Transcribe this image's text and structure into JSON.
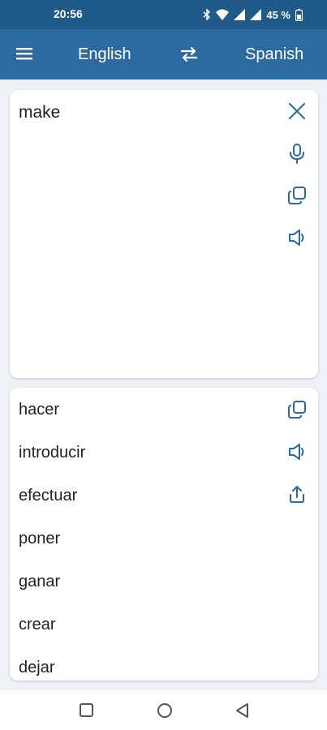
{
  "status_bar": {
    "time": "20:56",
    "battery": "45 %"
  },
  "app_bar": {
    "menu_icon": "menu-icon",
    "source_language": "English",
    "swap_icon": "swap-icon",
    "target_language": "Spanish"
  },
  "input": {
    "text": "make",
    "actions": [
      "clear-icon",
      "microphone-icon",
      "copy-icon",
      "speaker-icon"
    ]
  },
  "output": {
    "translations": [
      "hacer",
      "introducir",
      "efectuar",
      "poner",
      "ganar",
      "crear",
      "dejar"
    ],
    "actions": [
      "copy-icon",
      "speaker-icon",
      "share-icon"
    ]
  },
  "colors": {
    "app_bar": "#2c6aa0",
    "status_bar": "#1f5a88",
    "background": "#eef1f5",
    "icon": "#2c6aa0"
  }
}
